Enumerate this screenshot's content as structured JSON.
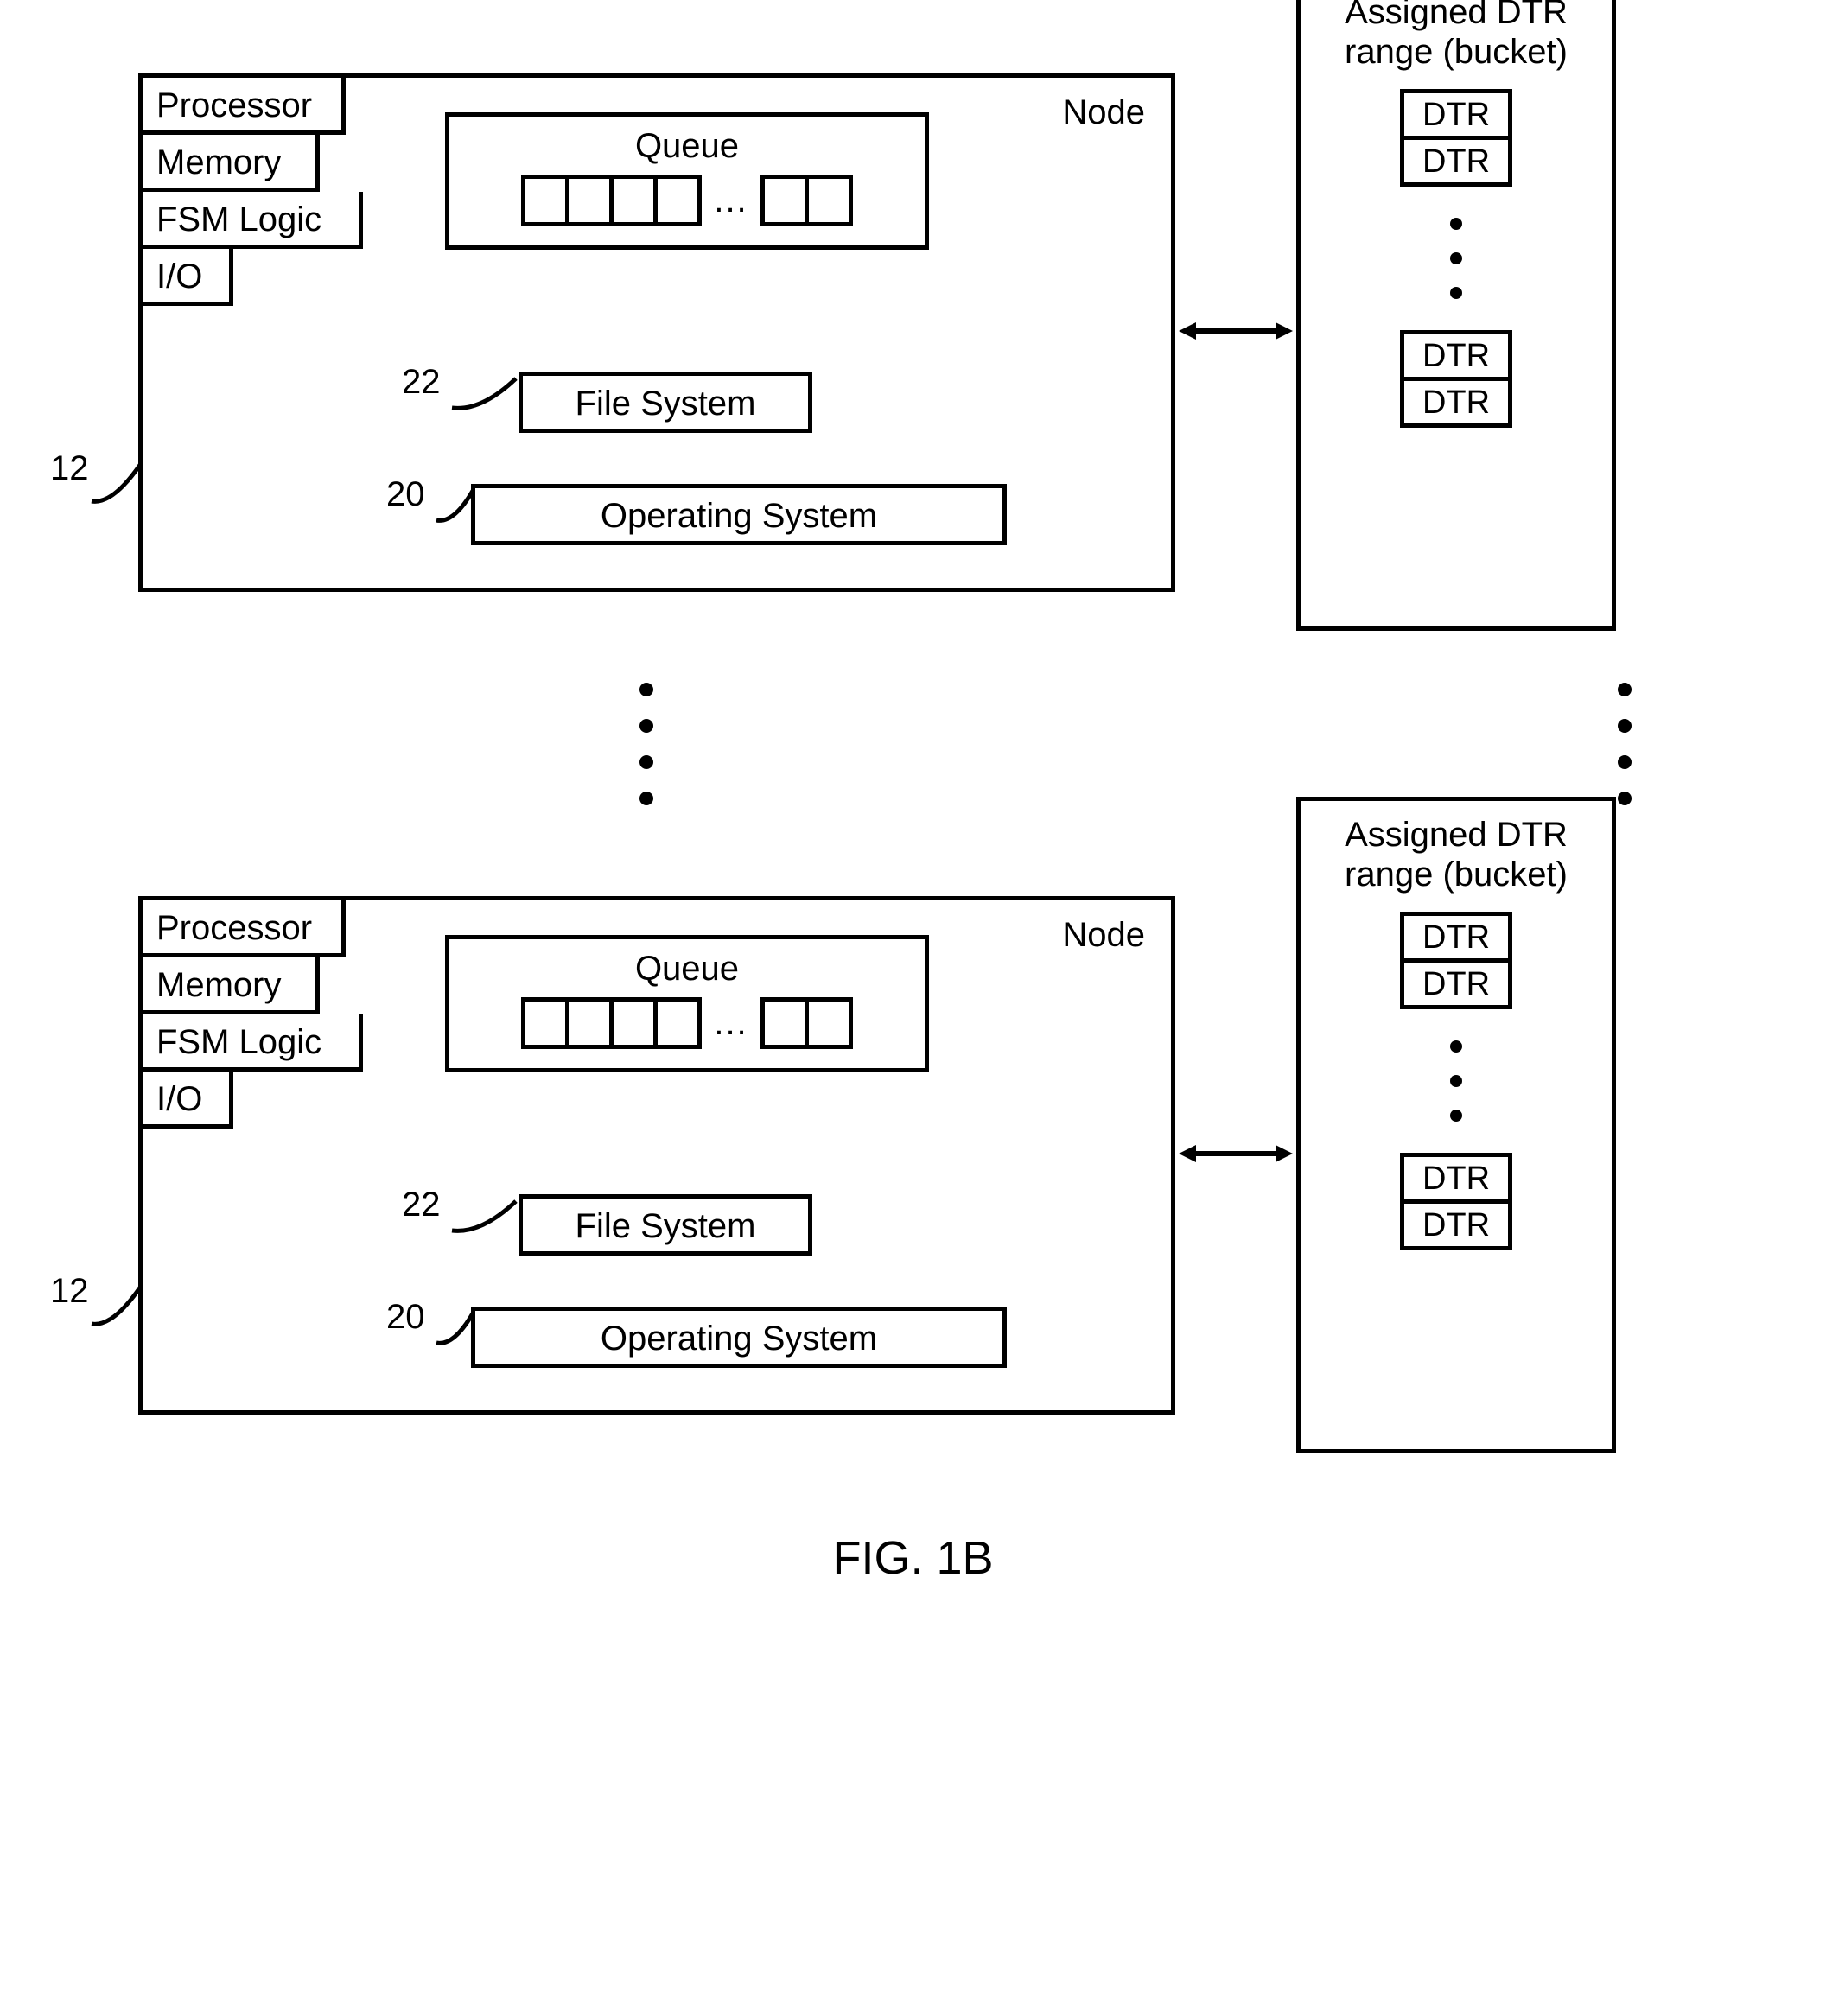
{
  "figure_label": "FIG. 1B",
  "node": {
    "title": "Node",
    "stack": [
      "Processor",
      "Memory",
      "FSM Logic",
      "I/O"
    ],
    "queue_label": "Queue",
    "queue_dots": "...",
    "file_system": "File System",
    "operating_system": "Operating System"
  },
  "refs": {
    "r12": "12",
    "r20": "20",
    "r22": "22"
  },
  "bucket": {
    "title_line1": "Assigned DTR",
    "title_line2": "range (bucket)",
    "cell": "DTR"
  }
}
